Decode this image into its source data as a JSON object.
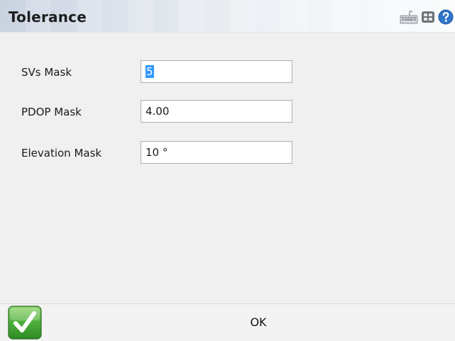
{
  "window": {
    "title": "Tolerance"
  },
  "header_icons": [
    {
      "name": "keyboard-icon"
    },
    {
      "name": "grid-icon"
    },
    {
      "name": "help-icon"
    }
  ],
  "form": {
    "svs_mask": {
      "label": "SVs Mask",
      "value": "5"
    },
    "pdop_mask": {
      "label": "PDOP Mask",
      "value": "4.00"
    },
    "elevation_mask": {
      "label": "Elevation Mask",
      "value": "10 °"
    }
  },
  "footer": {
    "ok_label": "OK",
    "ok_icon": "checkmark-icon"
  },
  "colors": {
    "selection": "#3399ff",
    "ok_icon_green": "#4caf3a",
    "help_blue": "#2f74c8"
  }
}
